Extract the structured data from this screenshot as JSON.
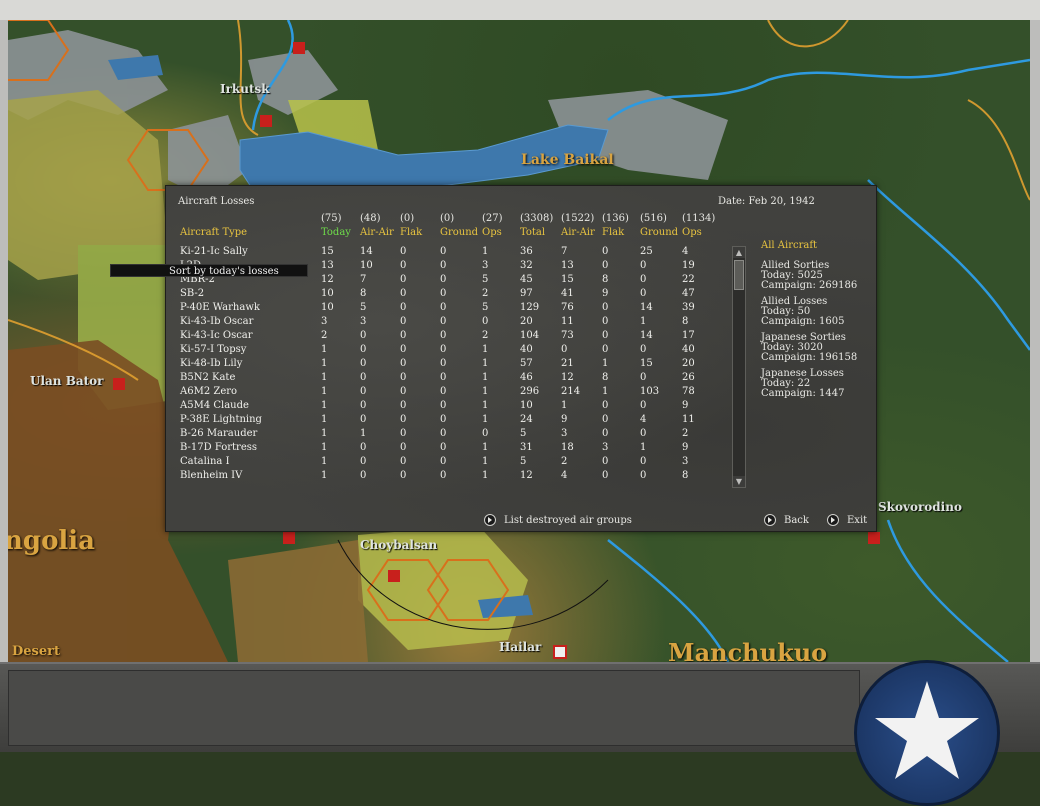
{
  "map": {
    "cities": [
      "Irkutsk",
      "Ulan Bator",
      "Choybalsan",
      "Hailar",
      "Skovorodino"
    ],
    "lake": "Lake Baikal",
    "regions": {
      "mongolia": "ngolia",
      "desert": "Desert",
      "manchukuo": "Manchukuo"
    }
  },
  "dialog": {
    "title": "Aircraft Losses",
    "date": "Date: Feb 20, 1942",
    "columns": [
      {
        "count": "",
        "label": "Aircraft Type"
      },
      {
        "count": "(75)",
        "label": "Today"
      },
      {
        "count": "(48)",
        "label": "Air-Air"
      },
      {
        "count": "(0)",
        "label": "Flak"
      },
      {
        "count": "(0)",
        "label": "Ground"
      },
      {
        "count": "(27)",
        "label": "Ops"
      },
      {
        "count": "(3308)",
        "label": "Total"
      },
      {
        "count": "(1522)",
        "label": "Air-Air"
      },
      {
        "count": "(136)",
        "label": "Flak"
      },
      {
        "count": "(516)",
        "label": "Ground"
      },
      {
        "count": "(1134)",
        "label": "Ops"
      }
    ],
    "rows": [
      [
        "Ki-21-Ic Sally",
        "15",
        "14",
        "0",
        "0",
        "1",
        "36",
        "7",
        "0",
        "25",
        "4"
      ],
      [
        "L2D",
        "13",
        "10",
        "0",
        "0",
        "3",
        "32",
        "13",
        "0",
        "0",
        "19"
      ],
      [
        "MBR-2",
        "12",
        "7",
        "0",
        "0",
        "5",
        "45",
        "15",
        "8",
        "0",
        "22"
      ],
      [
        "SB-2",
        "10",
        "8",
        "0",
        "0",
        "2",
        "97",
        "41",
        "9",
        "0",
        "47"
      ],
      [
        "P-40E Warhawk",
        "10",
        "5",
        "0",
        "0",
        "5",
        "129",
        "76",
        "0",
        "14",
        "39"
      ],
      [
        "Ki-43-Ib Oscar",
        "3",
        "3",
        "0",
        "0",
        "0",
        "20",
        "11",
        "0",
        "1",
        "8"
      ],
      [
        "Ki-43-Ic Oscar",
        "2",
        "0",
        "0",
        "0",
        "2",
        "104",
        "73",
        "0",
        "14",
        "17"
      ],
      [
        "Ki-57-I Topsy",
        "1",
        "0",
        "0",
        "0",
        "1",
        "40",
        "0",
        "0",
        "0",
        "40"
      ],
      [
        "Ki-48-Ib Lily",
        "1",
        "0",
        "0",
        "0",
        "1",
        "57",
        "21",
        "1",
        "15",
        "20"
      ],
      [
        "B5N2 Kate",
        "1",
        "0",
        "0",
        "0",
        "1",
        "46",
        "12",
        "8",
        "0",
        "26"
      ],
      [
        "A6M2 Zero",
        "1",
        "0",
        "0",
        "0",
        "1",
        "296",
        "214",
        "1",
        "103",
        "78"
      ],
      [
        "A5M4 Claude",
        "1",
        "0",
        "0",
        "0",
        "1",
        "10",
        "1",
        "0",
        "0",
        "9"
      ],
      [
        "P-38E Lightning",
        "1",
        "0",
        "0",
        "0",
        "1",
        "24",
        "9",
        "0",
        "4",
        "11"
      ],
      [
        "B-26 Marauder",
        "1",
        "1",
        "0",
        "0",
        "0",
        "5",
        "3",
        "0",
        "0",
        "2"
      ],
      [
        "B-17D Fortress",
        "1",
        "0",
        "0",
        "0",
        "1",
        "31",
        "18",
        "3",
        "1",
        "9"
      ],
      [
        "Catalina I",
        "1",
        "0",
        "0",
        "0",
        "1",
        "5",
        "2",
        "0",
        "0",
        "3"
      ],
      [
        "Blenheim IV",
        "1",
        "0",
        "0",
        "0",
        "1",
        "12",
        "4",
        "0",
        "0",
        "8"
      ]
    ],
    "tooltip": "Sort by today's losses",
    "summary": {
      "title": "All Aircraft",
      "allied_sorties": {
        "label": "Allied Sorties",
        "today": "Today:   5025",
        "campaign": "Campaign: 269186"
      },
      "allied_losses": {
        "label": "Allied Losses",
        "today": "Today:   50",
        "campaign": "Campaign: 1605"
      },
      "japanese_sorties": {
        "label": "Japanese Sorties",
        "today": "Today:   3020",
        "campaign": "Campaign: 196158"
      },
      "japanese_losses": {
        "label": "Japanese Losses",
        "today": "Today:   22",
        "campaign": "Campaign: 1447"
      }
    },
    "buttons": {
      "list_destroyed": "List destroyed air groups",
      "back": "Back",
      "exit": "Exit"
    }
  }
}
